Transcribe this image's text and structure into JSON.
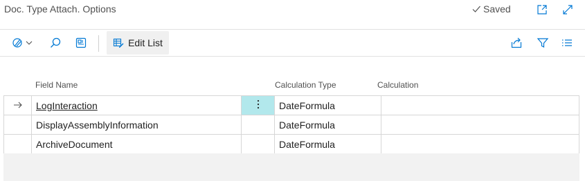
{
  "header": {
    "title": "Doc. Type Attach. Options",
    "status": "Saved"
  },
  "toolbar": {
    "edit_list_label": "Edit List"
  },
  "grid": {
    "columns": {
      "field_name": "Field Name",
      "calculation_type": "Calculation Type",
      "calculation": "Calculation"
    },
    "rows": [
      {
        "field_name": "LogInteraction",
        "calculation_type": "DateFormula",
        "calculation": "",
        "selected": true
      },
      {
        "field_name": "DisplayAssemblyInformation",
        "calculation_type": "DateFormula",
        "calculation": ""
      },
      {
        "field_name": "ArchiveDocument",
        "calculation_type": "DateFormula",
        "calculation": ""
      }
    ]
  },
  "colors": {
    "accent": "#0078d4",
    "selected_cell": "#b2e8ec"
  }
}
